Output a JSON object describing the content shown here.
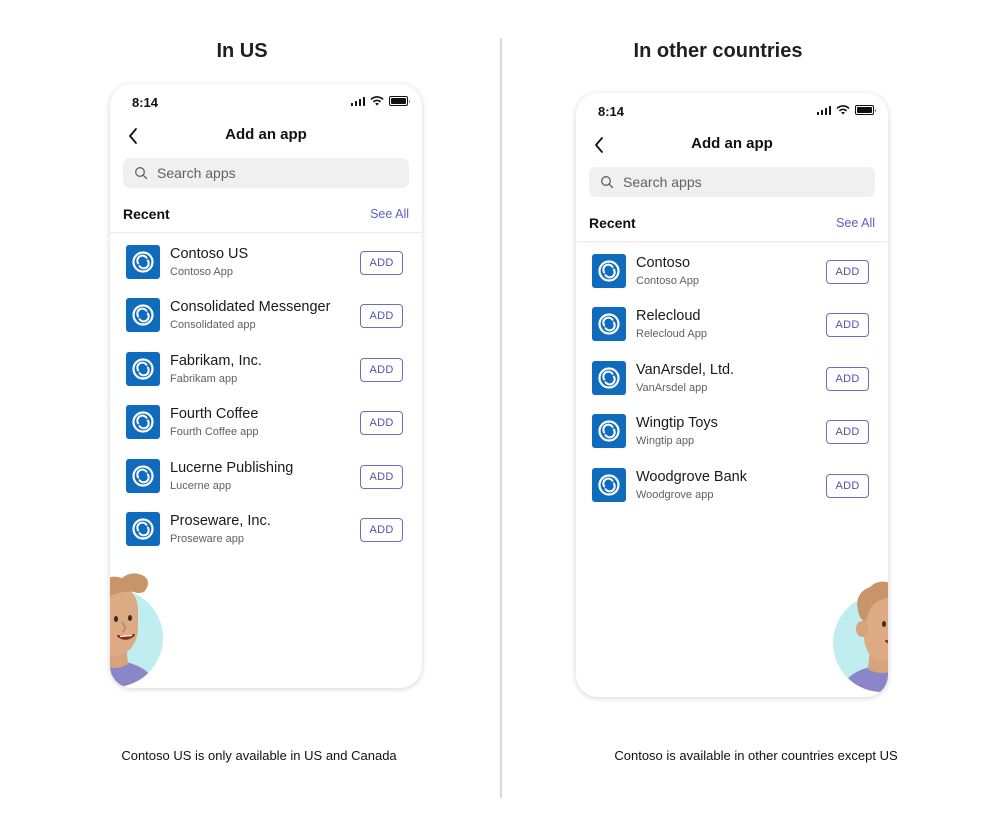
{
  "left": {
    "heading": "In US",
    "caption": "Contoso US is only available in US and Canada",
    "phone": {
      "time": "8:14",
      "title": "Add an app",
      "search_placeholder": "Search apps",
      "section": "Recent",
      "see_all": "See All",
      "apps": [
        {
          "name": "Contoso US",
          "subtitle": "Contoso App",
          "button": "ADD"
        },
        {
          "name": "Consolidated Messenger",
          "subtitle": "Consolidated app",
          "button": "ADD"
        },
        {
          "name": "Fabrikam, Inc.",
          "subtitle": "Fabrikam app",
          "button": "ADD"
        },
        {
          "name": "Fourth Coffee",
          "subtitle": "Fourth Coffee app",
          "button": "ADD"
        },
        {
          "name": "Lucerne Publishing",
          "subtitle": "Lucerne app",
          "button": "ADD"
        },
        {
          "name": "Proseware, Inc.",
          "subtitle": "Proseware app",
          "button": "ADD"
        }
      ]
    }
  },
  "right": {
    "heading": "In other countries",
    "caption": "Contoso is available in other countries except US",
    "phone": {
      "time": "8:14",
      "title": "Add an app",
      "search_placeholder": "Search apps",
      "section": "Recent",
      "see_all": "See All",
      "apps": [
        {
          "name": "Contoso",
          "subtitle": "Contoso App",
          "button": "ADD"
        },
        {
          "name": "Relecloud",
          "subtitle": "Relecloud App",
          "button": "ADD"
        },
        {
          "name": "VanArsdel, Ltd.",
          "subtitle": "VanArsdel app",
          "button": "ADD"
        },
        {
          "name": "Wingtip Toys",
          "subtitle": "Wingtip app",
          "button": "ADD"
        },
        {
          "name": "Woodgrove Bank",
          "subtitle": "Woodgrove  app",
          "button": "ADD"
        }
      ]
    }
  },
  "colors": {
    "app_icon": "#0f6cbd",
    "accent": "#5b5fc7",
    "avatar_bg": "#c0eef0",
    "shirt": "#8b86c7"
  }
}
